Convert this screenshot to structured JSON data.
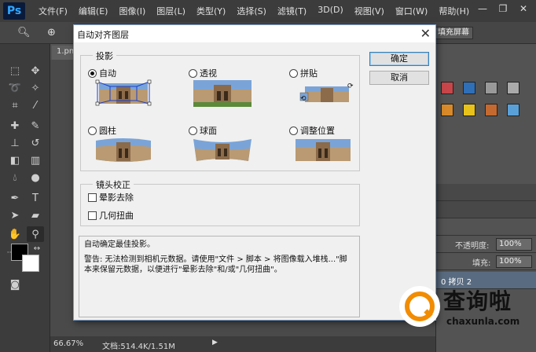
{
  "app": {
    "logo": "Ps"
  },
  "menu": [
    "文件(F)",
    "编辑(E)",
    "图像(I)",
    "图层(L)",
    "类型(Y)",
    "选择(S)",
    "滤镜(T)",
    "3D(D)",
    "视图(V)",
    "窗口(W)",
    "帮助(H)"
  ],
  "window_controls": {
    "minimize": "—",
    "restore": "❐",
    "close": "✕"
  },
  "options_bar": {
    "fill_screen_label": "填充屏幕"
  },
  "document_tab": {
    "label": "1.pn"
  },
  "status": {
    "zoom": "66.67%",
    "doc_info": "文档:514.4K/1.51M"
  },
  "dialog": {
    "title": "自动对齐图层",
    "projection_legend": "投影",
    "projection_options": [
      {
        "label": "自动",
        "selected": true
      },
      {
        "label": "透视",
        "selected": false
      },
      {
        "label": "拼贴",
        "selected": false
      },
      {
        "label": "圆柱",
        "selected": false
      },
      {
        "label": "球面",
        "selected": false
      },
      {
        "label": "调整位置",
        "selected": false
      }
    ],
    "lens_legend": "镜头校正",
    "lens_options": [
      {
        "label": "晕影去除",
        "checked": false
      },
      {
        "label": "几何扭曲",
        "checked": false
      }
    ],
    "ok_label": "确定",
    "cancel_label": "取消",
    "desc_line1": "自动确定最佳投影。",
    "desc_line2": "警告: 无法检测到相机元数据。请使用\"文件 > 脚本 > 将图像载入堆栈...\"脚本来保留元数据，以便进行\"晕影去除\"和/或\"几何扭曲\"。"
  },
  "layers_panel": {
    "opacity_label": "不透明度:",
    "opacity_value": "100%",
    "fill_label": "填充:",
    "fill_value": "100%",
    "layer_name": "0 拷贝 2"
  },
  "watermark": {
    "name": "查询啦",
    "url": "chaxunla.com"
  }
}
